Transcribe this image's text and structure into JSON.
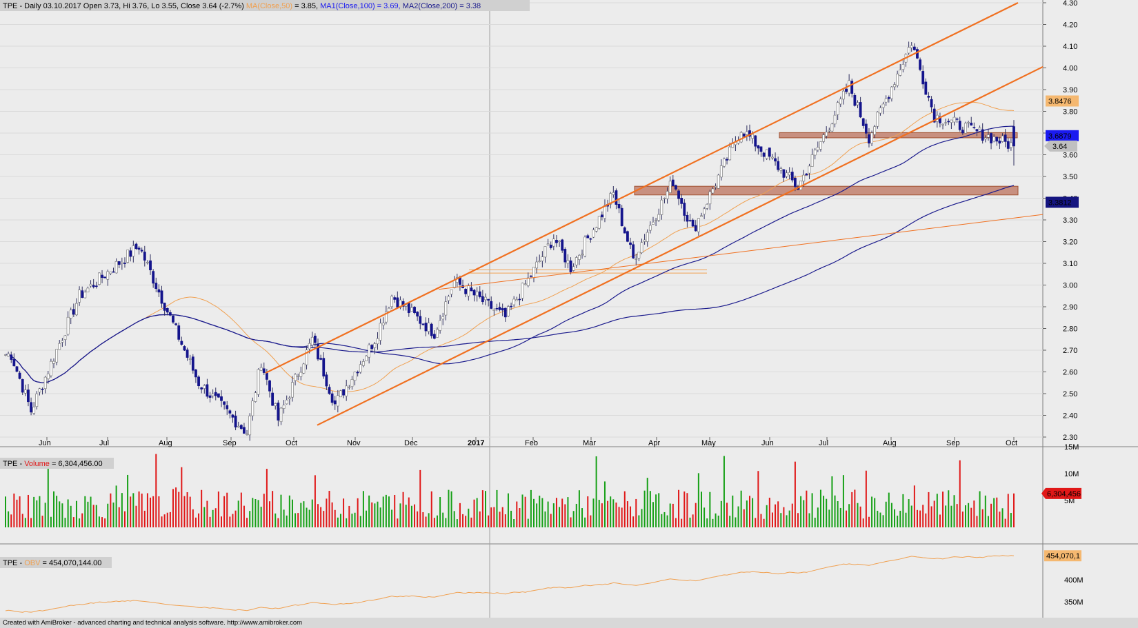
{
  "header": {
    "ticker": "TPE",
    "text_main": " - Daily 03.10.2017 Open 3.73, Hi 3.76, Lo 3.55, Close 3.64 (-2.7%) ",
    "ma_label": "MA(Close,50)",
    "ma_value": " = 3.85, ",
    "ma1_text": "MA1(Close,100) = 3.69, ",
    "ma2_text": "MA2(Close,200) = 3.38"
  },
  "volume_header": {
    "ticker": "TPE",
    "dash": " - ",
    "label": "Volume",
    "value": " = 6,304,456.00"
  },
  "obv_header": {
    "ticker": "TPE",
    "dash": " - ",
    "label": "OBV",
    "value": " = 454,070,144.00"
  },
  "footer_text": "Created with AmiBroker - advanced charting and technical analysis software. http://www.amibroker.com",
  "colors": {
    "up_candle": "#ffffff",
    "down_candle": "#14148c",
    "ma50": "#f0a050",
    "ma100": "#1a1a8c",
    "ma200": "#1a1a8c",
    "trendline": "#f07020",
    "zone_fill": "#c89080",
    "vol_up": "#16a016",
    "vol_down": "#e01818",
    "obv": "#f0a050"
  },
  "price_axis": [
    "4.30",
    "4.20",
    "4.10",
    "4.00",
    "3.90",
    "3.80",
    "3.70",
    "3.60",
    "3.50",
    "3.40",
    "3.30",
    "3.20",
    "3.10",
    "3.00",
    "2.90",
    "2.80",
    "2.70",
    "2.60",
    "2.50",
    "2.40",
    "2.30"
  ],
  "price_tags": [
    {
      "value": "3.8476",
      "bg": "#f5b870",
      "fg": "#000000"
    },
    {
      "value": "3.6879",
      "bg": "#1a1af0",
      "fg": "#ffffff"
    },
    {
      "value": "3.64",
      "bg": "#c0c0c0",
      "fg": "#000000"
    },
    {
      "value": "3.3812",
      "bg": "#141480",
      "fg": "#ffffff"
    }
  ],
  "volume_axis": [
    "15M",
    "10M",
    "5M"
  ],
  "volume_tag": "6,304,456",
  "obv_axis": [
    "400M",
    "350M"
  ],
  "obv_tag": "454,070,1",
  "months": [
    "Jun",
    "Jul",
    "Aug",
    "Sep",
    "Oct",
    "Nov",
    "Dec",
    "2017",
    "Feb",
    "Mar",
    "Apr",
    "May",
    "Jun",
    "Jul",
    "Aug",
    "Sep",
    "Oct"
  ],
  "chart_data": {
    "type": "candlestick",
    "title": "TPE - Daily 03.10.2017",
    "ylim": [
      2.3,
      4.3
    ],
    "key_points": [
      {
        "x": "Jun 2016",
        "y": 2.68
      },
      {
        "x": "Jun 2016",
        "y": 2.42
      },
      {
        "x": "Jul 2016",
        "y": 2.95
      },
      {
        "x": "Aug 2016",
        "y": 3.18
      },
      {
        "x": "Sep 2016",
        "y": 2.55
      },
      {
        "x": "Oct 2016",
        "y": 2.32
      },
      {
        "x": "Oct 2016",
        "y": 2.65
      },
      {
        "x": "Oct 2016",
        "y": 2.38
      },
      {
        "x": "Nov 2016",
        "y": 2.75
      },
      {
        "x": "Nov 2016",
        "y": 2.45
      },
      {
        "x": "Dec 2016",
        "y": 2.75
      },
      {
        "x": "Dec 2016",
        "y": 2.95
      },
      {
        "x": "Jan 2017",
        "y": 2.78
      },
      {
        "x": "Jan 2017",
        "y": 3.02
      },
      {
        "x": "Feb 2017",
        "y": 2.85
      },
      {
        "x": "Mar 2017",
        "y": 3.22
      },
      {
        "x": "Mar 2017",
        "y": 3.08
      },
      {
        "x": "Apr 2017",
        "y": 3.42
      },
      {
        "x": "Apr 2017",
        "y": 3.12
      },
      {
        "x": "May 2017",
        "y": 3.48
      },
      {
        "x": "May 2017",
        "y": 3.25
      },
      {
        "x": "Jun 2017",
        "y": 3.72
      },
      {
        "x": "Jul 2017",
        "y": 3.45
      },
      {
        "x": "Aug 2017",
        "y": 3.92
      },
      {
        "x": "Aug 2017",
        "y": 3.68
      },
      {
        "x": "Sep 2017",
        "y": 4.12
      },
      {
        "x": "Sep 2017",
        "y": 3.78
      },
      {
        "x": "Oct 2017",
        "y": 3.64
      }
    ],
    "last_bar": {
      "date": "03.10.2017",
      "open": 3.73,
      "high": 3.76,
      "low": 3.55,
      "close": 3.64,
      "change_pct": -2.7
    },
    "moving_averages": [
      {
        "name": "MA(Close,50)",
        "value": 3.85
      },
      {
        "name": "MA1(Close,100)",
        "value": 3.69
      },
      {
        "name": "MA2(Close,200)",
        "value": 3.38
      }
    ],
    "volume": {
      "last": 6304456.0,
      "ylim_millions": [
        0,
        15
      ]
    },
    "obv": {
      "last": 454070144.0
    }
  }
}
